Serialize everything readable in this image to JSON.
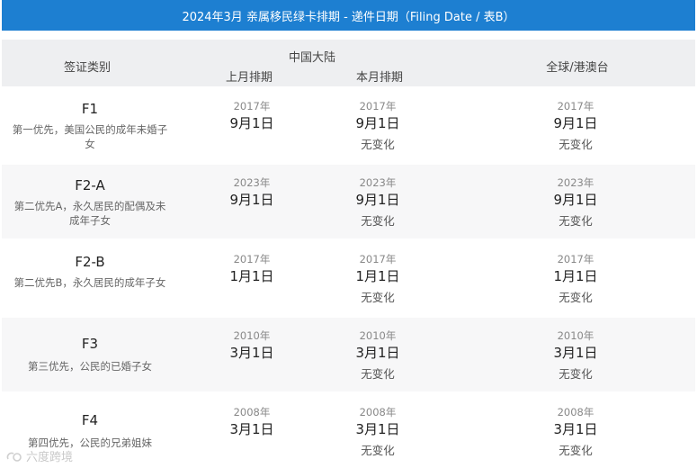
{
  "title": "2024年3月 亲属移民绿卡排期 - 递件日期（Filing Date / 表B）",
  "header": {
    "category": "签证类别",
    "china": "中国大陆",
    "prev_month": "上月排期",
    "cur_month": "本月排期",
    "global": "全球/港澳台"
  },
  "rows": [
    {
      "name": "F1",
      "desc": "第一优先，美国公民的成年未婚子女",
      "prev": {
        "year": "2017年",
        "date": "9月1日"
      },
      "cur": {
        "year": "2017年",
        "date": "9月1日",
        "change": "无变化"
      },
      "global": {
        "year": "2017年",
        "date": "9月1日",
        "change": "无变化"
      }
    },
    {
      "name": "F2-A",
      "desc": "第二优先A，永久居民的配偶及未成年子女",
      "prev": {
        "year": "2023年",
        "date": "9月1日"
      },
      "cur": {
        "year": "2023年",
        "date": "9月1日",
        "change": "无变化"
      },
      "global": {
        "year": "2023年",
        "date": "9月1日",
        "change": "无变化"
      }
    },
    {
      "name": "F2-B",
      "desc": "第二优先B，永久居民的成年子女",
      "prev": {
        "year": "2017年",
        "date": "1月1日"
      },
      "cur": {
        "year": "2017年",
        "date": "1月1日",
        "change": "无变化"
      },
      "global": {
        "year": "2017年",
        "date": "1月1日",
        "change": "无变化"
      }
    },
    {
      "name": "F3",
      "desc": "第三优先，公民的已婚子女",
      "prev": {
        "year": "2010年",
        "date": "3月1日"
      },
      "cur": {
        "year": "2010年",
        "date": "3月1日",
        "change": "无变化"
      },
      "global": {
        "year": "2010年",
        "date": "3月1日",
        "change": "无变化"
      }
    },
    {
      "name": "F4",
      "desc": "第四优先，公民的兄弟姐妹",
      "prev": {
        "year": "2008年",
        "date": "3月1日"
      },
      "cur": {
        "year": "2008年",
        "date": "3月1日",
        "change": "无变化"
      },
      "global": {
        "year": "2008年",
        "date": "3月1日",
        "change": "无变化"
      }
    }
  ],
  "watermark": "六度跨境",
  "colors": {
    "title_bar": "#1d7fd1",
    "header_bg": "#eeeff1",
    "alt_row": "#f7f7f8"
  }
}
